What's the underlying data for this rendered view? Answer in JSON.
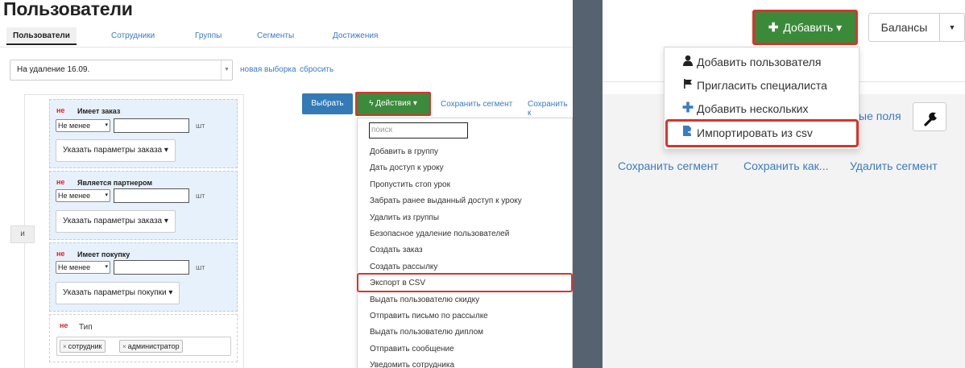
{
  "left": {
    "page_title": "Пользователи",
    "tabs": [
      {
        "label": "Пользователи",
        "active": true
      },
      {
        "label": "Сотрудники"
      },
      {
        "label": "Группы"
      },
      {
        "label": "Сегменты"
      },
      {
        "label": "Достижения"
      }
    ],
    "filter_select": {
      "value": "На удаление 16.09."
    },
    "new_selection_link": "новая выборка",
    "reset_link": "сбросить",
    "and_label": "и",
    "conditions": [
      {
        "neg": "не",
        "title": "Имеет заказ",
        "select": "Не менее",
        "unit": "шт",
        "param_button": "Указать параметры заказа"
      },
      {
        "neg": "не",
        "title": "Является партнером",
        "select": "Не менее",
        "unit": "шт",
        "param_button": "Указать параметры заказа"
      },
      {
        "neg": "не",
        "title": "Имеет покупку",
        "select": "Не менее",
        "unit": "шт",
        "param_button": "Указать параметры покупки"
      }
    ],
    "type_condition": {
      "neg": "не",
      "title": "Тип",
      "tags": [
        "сотрудник",
        "администратор"
      ]
    },
    "select_button": "Выбрать",
    "actions_button": "Действия",
    "save_segment_link": "Сохранить сегмент",
    "save_as_link": "Сохранить к",
    "actions_menu": {
      "search_placeholder": "поиск",
      "items": [
        "Добавить в группу",
        "Дать доступ к уроку",
        "Пропустить стоп урок",
        "Забрать ранее выданный доступ к уроку",
        "Удалить из группы",
        "Безопасное удаление пользователей",
        "Создать заказ",
        "Создать рассылку",
        "Экспорт в CSV",
        "Выдать пользователю скидку",
        "Отправить письмо по рассылке",
        "Выдать пользователю диплом",
        "Отправить сообщение",
        "Уведомить сотрудника"
      ],
      "highlighted_item": "Экспорт в CSV"
    }
  },
  "right": {
    "add_button": "Добавить",
    "balances_button": "Балансы",
    "add_menu": [
      {
        "icon": "user-icon",
        "label": "Добавить пользователя"
      },
      {
        "icon": "flag-icon",
        "label": "Пригласить специалиста"
      },
      {
        "icon": "plus-icon",
        "label": "Добавить нескольких"
      },
      {
        "icon": "import-icon",
        "label": "Импортировать из csv"
      }
    ],
    "highlighted_item": "Импортировать из csv",
    "fields_link_partial": "ые поля",
    "save_segment_link": "Сохранить сегмент",
    "save_as_link": "Сохранить как...",
    "delete_segment_link": "Удалить сегмент"
  },
  "colors": {
    "primary_blue": "#337ab7",
    "green": "#3c8a3c",
    "highlight_red": "#d9342b",
    "divider": "#56626f",
    "link": "#3a7bc4",
    "negation_red": "#d9262b"
  }
}
